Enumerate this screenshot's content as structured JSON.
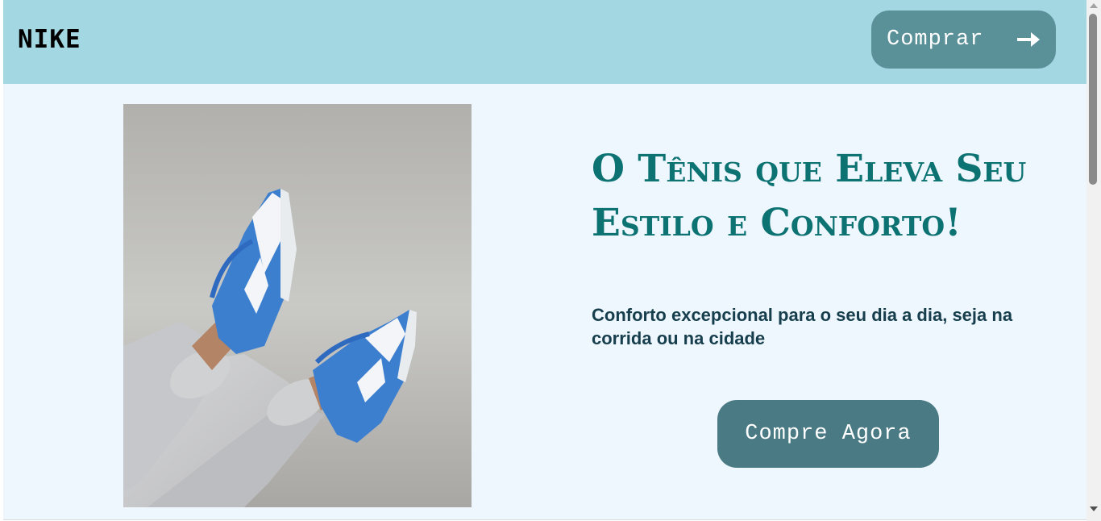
{
  "header": {
    "logo": "NIKE",
    "buy_button_label": "Comprar",
    "buy_button_icon": "arrow-right-icon"
  },
  "hero": {
    "image_icon": "sneakers-photo",
    "headline": "O Tênis que Eleva Seu Estilo e Conforto!",
    "subtext": "Conforto excepcional para o seu dia a dia, seja na corrida ou na cidade",
    "cta_label": "Compre Agora"
  },
  "colors": {
    "header_bg": "#a3d7e2",
    "page_bg": "#eef6fe",
    "button_bg": "#5a9098",
    "cta_bg": "#4a7a84",
    "headline": "#0c7272",
    "subtext": "#163e4c"
  }
}
